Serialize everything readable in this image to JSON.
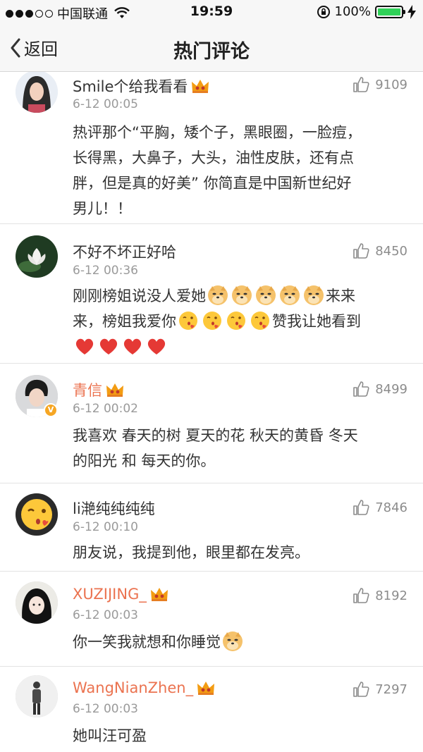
{
  "status_bar": {
    "carrier": "中国联通",
    "time": "19:59",
    "battery": "100%",
    "battery_level": 1.0,
    "signal_bars": 3
  },
  "nav": {
    "back_label": "返回",
    "title": "热门评论"
  },
  "colors": {
    "vip_name": "#eb7350",
    "text": "#333333",
    "secondary": "#9a9a9a",
    "like": "#8c8c8c"
  },
  "comments": [
    {
      "username": "Smile个给我看看",
      "vip": false,
      "crown": true,
      "time": "6-12 00:05",
      "likes": "9109",
      "text_lines": [
        "热评那个“平胸，矮个子，黑眼圈，一脸痘，",
        "长得黑，大鼻子，大头，油性皮肤，还有点",
        "胖，但是真的好美” 你简直是中国新世纪好",
        "男儿！！"
      ],
      "avatar_icon": "avatar-girl-icon"
    },
    {
      "username": "不好不坏正好哈",
      "vip": false,
      "crown": false,
      "time": "6-12 00:36",
      "likes": "8450",
      "text_parts": {
        "line1": "刚刚榜姐说没人爱她",
        "line1_end": "来来",
        "line2": "来，榜姐我爱你",
        "line2_end": "赞我让她看到"
      },
      "emoji_doge_count": 5,
      "emoji_kiss_count": 4,
      "emoji_heart_count": 4,
      "avatar_icon": "avatar-lotus-icon"
    },
    {
      "username": "青信",
      "vip": true,
      "crown": true,
      "verified": true,
      "time": "6-12 00:02",
      "likes": "8499",
      "text_lines": [
        "我喜欢 春天的树 夏天的花 秋天的黄昏 冬天",
        "的阳光 和 每天的你。"
      ],
      "avatar_icon": "avatar-boy-icon"
    },
    {
      "username": "li滟纯纯纯纯",
      "vip": false,
      "crown": false,
      "time": "6-12 00:10",
      "likes": "7846",
      "text_lines": [
        "朋友说，我提到他，眼里都在发亮。"
      ],
      "avatar_icon": "avatar-kiss-emoji-icon"
    },
    {
      "username": "XUZIJING_",
      "vip": true,
      "crown": true,
      "time": "6-12 00:03",
      "likes": "8192",
      "text": "你一笑我就想和你睡觉",
      "avatar_icon": "avatar-girl-cartoon-icon"
    },
    {
      "username": "WangNianZhen_",
      "vip": true,
      "crown": true,
      "time": "6-12 00:03",
      "likes": "7297",
      "text_lines": [
        "她叫汪可盈"
      ],
      "avatar_icon": "avatar-man-standing-icon"
    }
  ]
}
